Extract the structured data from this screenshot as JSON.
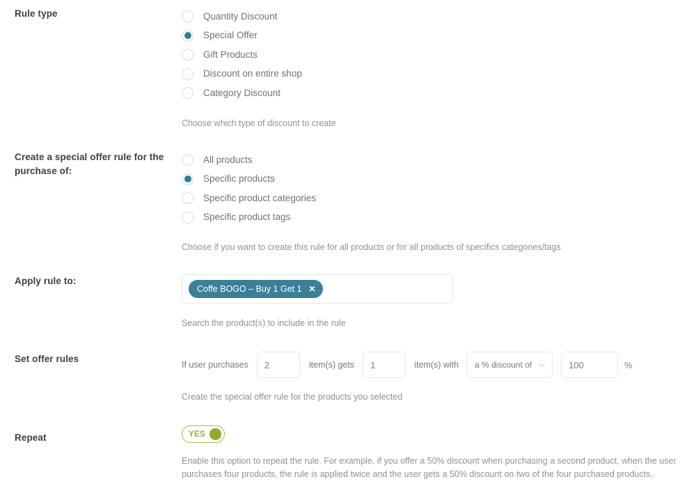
{
  "sections": {
    "rule_type": {
      "label": "Rule type",
      "options": [
        {
          "label": "Quantity Discount",
          "selected": false
        },
        {
          "label": "Special Offer",
          "selected": true
        },
        {
          "label": "Gift Products",
          "selected": false
        },
        {
          "label": "Discount on entire shop",
          "selected": false
        },
        {
          "label": "Category Discount",
          "selected": false
        }
      ],
      "help": "Choose which type of discount to create"
    },
    "purchase_of": {
      "label": "Create a special offer rule for the purchase of:",
      "options": [
        {
          "label": "All products",
          "selected": false
        },
        {
          "label": "Specific products",
          "selected": true
        },
        {
          "label": "Specific product categories",
          "selected": false
        },
        {
          "label": "Specific product tags",
          "selected": false
        }
      ],
      "help": "Choose if you want to create this rule for all products or for all products of specifics categories/tags"
    },
    "apply_rule_to": {
      "label": "Apply rule to:",
      "tokens": [
        {
          "text": "Coffe BOGO – Buy 1 Get 1",
          "remove": "✕"
        }
      ],
      "help": "Search the product(s) to include in the rule"
    },
    "offer_rules": {
      "label": "Set offer rules",
      "prefix_text": "If user purchases",
      "quantity_purchased": "2",
      "middle_text": "item(s) gets",
      "quantity_free": "1",
      "suffix_text": "item(s) with",
      "discount_type": "a % discount of",
      "discount_value": "100",
      "unit": "%",
      "help": "Create the special offer rule for the products you selected"
    },
    "repeat": {
      "label": "Repeat",
      "toggle_state": "YES",
      "help": "Enable this option to repeat the rule. For example, if you offer a 50% discount when purchasing a second product, when the user purchases four products, the rule is applied twice and the user gets a 50% discount on two of the four purchased products."
    }
  },
  "colors": {
    "radio_selected": "#2f7e96",
    "token_bg": "#3b7f98",
    "toggle_green": "#8faa2e"
  }
}
